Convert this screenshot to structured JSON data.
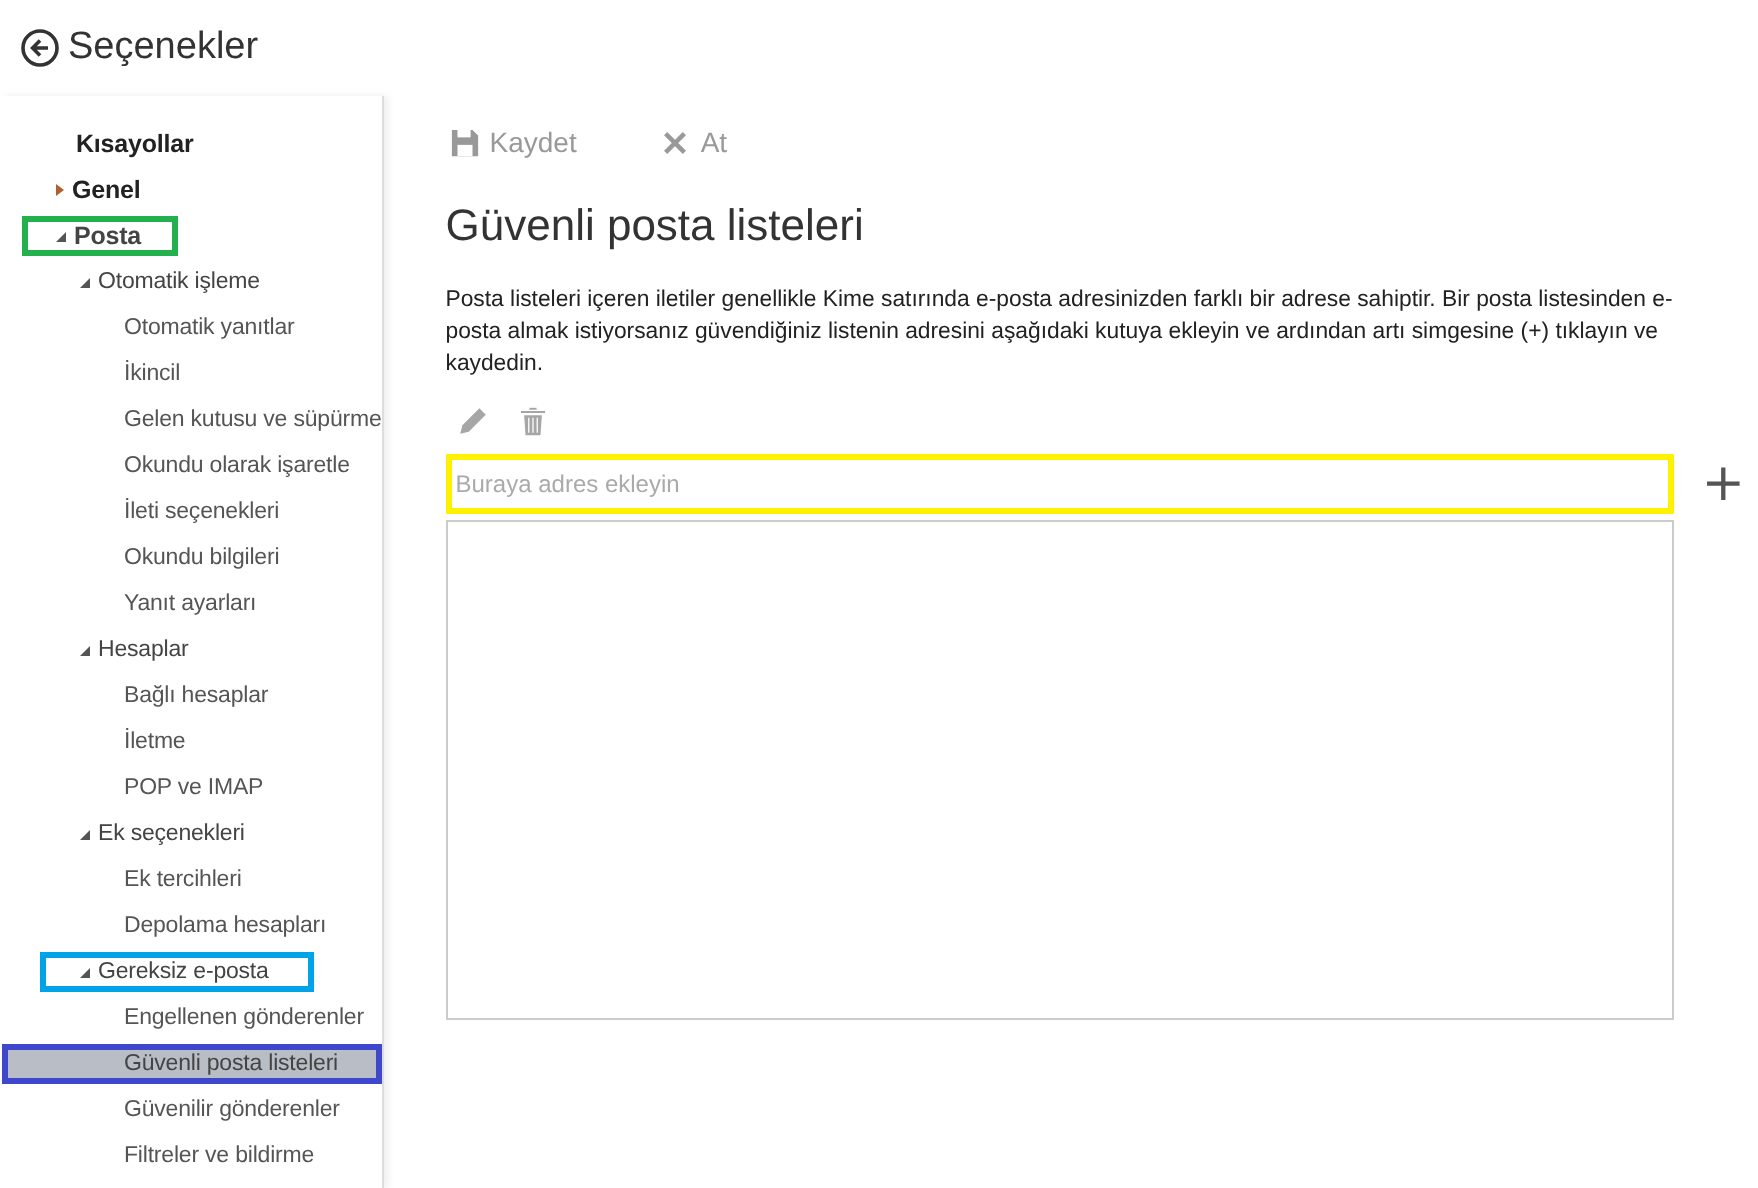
{
  "header": {
    "title": "Seçenekler"
  },
  "nav": [
    {
      "label": "Kısayollar",
      "kind": "link",
      "selected": false
    },
    {
      "label": "Genel",
      "kind": "group",
      "expanded": false,
      "selected": false
    },
    {
      "label": "Posta",
      "kind": "group",
      "expanded": true,
      "selected": false,
      "color": "#22b14c",
      "children": [
        {
          "label": "Otomatik işleme",
          "kind": "group",
          "expanded": true,
          "selected": false,
          "children": [
            {
              "label": "Otomatik yanıtlar",
              "kind": "link",
              "selected": false
            },
            {
              "label": "İkincil",
              "kind": "link",
              "selected": false
            },
            {
              "label": "Gelen kutusu ve süpürme",
              "kind": "link",
              "selected": false
            },
            {
              "label": "Okundu olarak işaretle",
              "kind": "link",
              "selected": false
            },
            {
              "label": "İleti seçenekleri",
              "kind": "link",
              "selected": false
            },
            {
              "label": "Okundu bilgileri",
              "kind": "link",
              "selected": false
            },
            {
              "label": "Yanıt ayarları",
              "kind": "link",
              "selected": false
            }
          ]
        },
        {
          "label": "Hesaplar",
          "kind": "group",
          "expanded": true,
          "selected": false,
          "children": [
            {
              "label": "Bağlı hesaplar",
              "kind": "link",
              "selected": false
            },
            {
              "label": "İletme",
              "kind": "link",
              "selected": false
            },
            {
              "label": "POP ve IMAP",
              "kind": "link",
              "selected": false
            }
          ]
        },
        {
          "label": "Ek seçenekleri",
          "kind": "group",
          "expanded": true,
          "selected": false,
          "children": [
            {
              "label": "Ek tercihleri",
              "kind": "link",
              "selected": false
            },
            {
              "label": "Depolama hesapları",
              "kind": "link",
              "selected": false
            }
          ]
        },
        {
          "label": "Gereksiz e-posta",
          "kind": "group",
          "expanded": true,
          "selected": false,
          "color": "#00a2e8",
          "children": [
            {
              "label": "Engellenen gönderenler",
              "kind": "link",
              "selected": false
            },
            {
              "label": "Güvenli posta listeleri",
              "kind": "link",
              "selected": true,
              "color": "#3f48cc"
            },
            {
              "label": "Güvenilir gönderenler",
              "kind": "link",
              "selected": false
            },
            {
              "label": "Filtreler ve bildirme",
              "kind": "link",
              "selected": false
            }
          ]
        }
      ]
    }
  ],
  "toolbar": [
    {
      "kind": "save",
      "label": "Kaydet"
    },
    {
      "kind": "discard",
      "label": "At"
    }
  ],
  "page": {
    "title": "Güvenli posta listeleri",
    "description": "Posta listeleri içeren iletiler genellikle Kime satırında e-posta adresinizden farklı bir adrese sahiptir. Bir posta listesinden e-posta almak istiyorsanız güvendiğiniz listenin adresini aşağıdaki kutuya ekleyin ve ardından artı simgesine (+) tıklayın ve kaydedin.",
    "address_field": {
      "placeholder": "Buraya adres ekleyin",
      "color": "#fff200"
    },
    "add_button": "+"
  }
}
